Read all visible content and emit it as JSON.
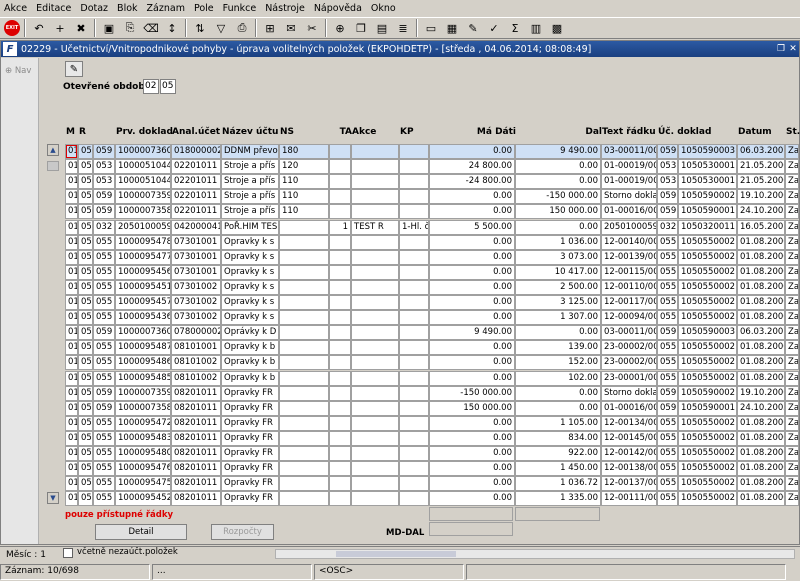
{
  "menu": [
    "Akce",
    "Editace",
    "Dotaz",
    "Blok",
    "Záznam",
    "Pole",
    "Funkce",
    "Nástroje",
    "Nápověda",
    "Okno"
  ],
  "toolbar_icons": [
    "exit-icon",
    "back-icon",
    "add-icon",
    "delete-icon",
    "save-icon",
    "copy-icon",
    "clear-icon",
    "sort-icon",
    "sort-desc-icon",
    "filter-icon",
    "print-icon",
    "attach-icon",
    "mail-icon",
    "cut-icon",
    "zoom-icon",
    "copy-doc-icon",
    "paste-icon",
    "list-icon",
    "doc-icon",
    "calc-icon",
    "edit-icon",
    "check-icon",
    "sum-icon",
    "chart-icon",
    "table-icon"
  ],
  "window": {
    "title": "02229 - Účetnictví/Vnitropodnikové pohyby - úprava volitelných položek (EKPOHDETP) - [středa , 04.06.2014; 08:08:49]",
    "nav_label": "Nav"
  },
  "period": {
    "label": "Otevřené období",
    "month": "02",
    "year": "05"
  },
  "columns": [
    {
      "key": "m",
      "label": "M",
      "align": "l"
    },
    {
      "key": "r",
      "label": "R",
      "align": "l"
    },
    {
      "key": "c",
      "label": "",
      "align": "l"
    },
    {
      "key": "doklad",
      "label": "Prv. doklad",
      "align": "l"
    },
    {
      "key": "anal",
      "label": "Anal.účet",
      "align": "l"
    },
    {
      "key": "nazev",
      "label": "Název účtu",
      "align": "l"
    },
    {
      "key": "ns",
      "label": "NS",
      "align": "l"
    },
    {
      "key": "ta",
      "label": "TA",
      "align": "r"
    },
    {
      "key": "akce",
      "label": "Akce",
      "align": "l"
    },
    {
      "key": "kp",
      "label": "KP",
      "align": "l"
    },
    {
      "key": "madati",
      "label": "Má Dáti",
      "align": "r"
    },
    {
      "key": "dal",
      "label": "Dal",
      "align": "r"
    },
    {
      "key": "text",
      "label": "Text řádku",
      "align": "l"
    },
    {
      "key": "uc",
      "label": "Úč. doklad",
      "align": "l"
    },
    {
      "key": "x",
      "label": "",
      "align": "l"
    },
    {
      "key": "datum",
      "label": "Datum",
      "align": "l"
    },
    {
      "key": "st",
      "label": "St.",
      "align": "l"
    }
  ],
  "rows": [
    [
      "01",
      "05",
      "059",
      "1000007360",
      "018000002",
      "DDNM převo",
      "180",
      "",
      "",
      "",
      "0.00",
      "9 490.00",
      "03-00011/000",
      "059",
      "1050590003",
      "06.03.2007",
      "Za"
    ],
    [
      "01",
      "05",
      "053",
      "1000051044",
      "02201011",
      "Stroje a přís",
      "120",
      "",
      "",
      "",
      "24 800.00",
      "0.00",
      "01-00019/000",
      "053",
      "1050530001",
      "21.05.2006",
      "Za"
    ],
    [
      "01",
      "05",
      "053",
      "1000051044",
      "02201011",
      "Stroje a přís",
      "110",
      "",
      "",
      "",
      "-24 800.00",
      "0.00",
      "01-00019/000",
      "053",
      "1050530001",
      "21.05.2006",
      "Za"
    ],
    [
      "01",
      "05",
      "059",
      "1000007359",
      "02201011",
      "Stroje a přís",
      "110",
      "",
      "",
      "",
      "0.00",
      "-150 000.00",
      "Storno doklad",
      "059",
      "1050590002",
      "19.10.2006",
      "Za"
    ],
    [
      "01",
      "05",
      "059",
      "1000007358",
      "02201011",
      "Stroje a přís",
      "110",
      "",
      "",
      "",
      "0.00",
      "150 000.00",
      "01-00016/000",
      "059",
      "1050590001",
      "24.10.2005",
      "Za"
    ],
    [
      "01",
      "05",
      "032",
      "2050100059",
      "042000041",
      "PoŘ.HIM TES",
      "",
      "1",
      "TEST R",
      "1-Hl. č",
      "5 500.00",
      "0.00",
      "2050100059 (",
      "032",
      "1050320011",
      "16.05.2007",
      "Za"
    ],
    [
      "01",
      "05",
      "055",
      "1000095478",
      "07301001",
      "Opravky k s",
      "",
      "",
      "",
      "",
      "0.00",
      "1 036.00",
      "12-00140/000",
      "055",
      "1050550002",
      "01.08.2006",
      "Za"
    ],
    [
      "01",
      "05",
      "055",
      "1000095477",
      "07301001",
      "Opravky k s",
      "",
      "",
      "",
      "",
      "0.00",
      "3 073.00",
      "12-00139/000",
      "055",
      "1050550002",
      "01.08.2006",
      "Za"
    ],
    [
      "01",
      "05",
      "055",
      "1000095456",
      "07301001",
      "Opravky k s",
      "",
      "",
      "",
      "",
      "0.00",
      "10 417.00",
      "12-00115/000",
      "055",
      "1050550002",
      "01.08.2006",
      "Za"
    ],
    [
      "01",
      "05",
      "055",
      "1000095451",
      "07301002",
      "Opravky k s",
      "",
      "",
      "",
      "",
      "0.00",
      "2 500.00",
      "12-00110/000",
      "055",
      "1050550002",
      "01.08.2006",
      "Za"
    ],
    [
      "01",
      "05",
      "055",
      "1000095457",
      "07301002",
      "Opravky k s",
      "",
      "",
      "",
      "",
      "0.00",
      "3 125.00",
      "12-00117/000",
      "055",
      "1050550002",
      "01.08.2006",
      "Za"
    ],
    [
      "01",
      "05",
      "055",
      "1000095436",
      "07301002",
      "Opravky k s",
      "",
      "",
      "",
      "",
      "0.00",
      "1 307.00",
      "12-00094/000",
      "055",
      "1050550002",
      "01.08.2006",
      "Za"
    ],
    [
      "01",
      "05",
      "059",
      "1000007360",
      "078000002",
      "Oprávky k D",
      "",
      "",
      "",
      "",
      "9 490.00",
      "0.00",
      "03-00011/000",
      "059",
      "1050590003",
      "06.03.2007",
      "Za"
    ],
    [
      "01",
      "05",
      "055",
      "1000095487",
      "08101001",
      "Opravky k b",
      "",
      "",
      "",
      "",
      "0.00",
      "139.00",
      "23-00002/000",
      "055",
      "1050550002",
      "01.08.2006",
      "Za"
    ],
    [
      "01",
      "05",
      "055",
      "1000095486",
      "08101002",
      "Opravky k b",
      "",
      "",
      "",
      "",
      "0.00",
      "152.00",
      "23-00002/000",
      "055",
      "1050550002",
      "01.08.2006",
      "Za"
    ],
    [
      "01",
      "05",
      "055",
      "1000095485",
      "08101002",
      "Opravky k b",
      "",
      "",
      "",
      "",
      "0.00",
      "102.00",
      "23-00001/000",
      "055",
      "1050550002",
      "01.08.2006",
      "Za"
    ],
    [
      "01",
      "05",
      "059",
      "1000007359",
      "08201011",
      "Opravky FR",
      "",
      "",
      "",
      "",
      "-150 000.00",
      "0.00",
      "Storno doklad",
      "059",
      "1050590002",
      "19.10.2006",
      "Za"
    ],
    [
      "01",
      "05",
      "059",
      "1000007358",
      "08201011",
      "Opravky FR",
      "",
      "",
      "",
      "",
      "150 000.00",
      "0.00",
      "01-00016/000",
      "059",
      "1050590001",
      "24.10.2005",
      "Za"
    ],
    [
      "01",
      "05",
      "055",
      "1000095472",
      "08201011",
      "Opravky FR",
      "",
      "",
      "",
      "",
      "0.00",
      "1 105.00",
      "12-00134/000",
      "055",
      "1050550002",
      "01.08.2006",
      "Za"
    ],
    [
      "01",
      "05",
      "055",
      "1000095483",
      "08201011",
      "Opravky FR",
      "",
      "",
      "",
      "",
      "0.00",
      "834.00",
      "12-00145/000",
      "055",
      "1050550002",
      "01.08.2006",
      "Za"
    ],
    [
      "01",
      "05",
      "055",
      "1000095480",
      "08201011",
      "Opravky FR",
      "",
      "",
      "",
      "",
      "0.00",
      "922.00",
      "12-00142/000",
      "055",
      "1050550002",
      "01.08.2006",
      "Za"
    ],
    [
      "01",
      "05",
      "055",
      "1000095476",
      "08201011",
      "Opravky FR",
      "",
      "",
      "",
      "",
      "0.00",
      "1 450.00",
      "12-00138/000",
      "055",
      "1050550002",
      "01.08.2006",
      "Za"
    ],
    [
      "01",
      "05",
      "055",
      "1000095475",
      "08201011",
      "Opravky FR",
      "",
      "",
      "",
      "",
      "0.00",
      "1 036.72",
      "12-00137/000",
      "055",
      "1050550002",
      "01.08.2006",
      "Za"
    ],
    [
      "01",
      "05",
      "055",
      "1000095452",
      "08201011",
      "Opravky FR",
      "",
      "",
      "",
      "",
      "0.00",
      "1 335.00",
      "12-00111/000",
      "055",
      "1050550002",
      "01.08.2006",
      "Za"
    ]
  ],
  "hint": "pouze přístupné řádky",
  "buttons": {
    "detail": "Detail",
    "rozpocty": "Rozpočty"
  },
  "md_dal_label": "MD-DAL",
  "checkbox_label": "včetně nezaúčt.položek",
  "status": {
    "mesic": "Měsíc : 1",
    "zaznam": "Záznam: 10/698",
    "dots": "...",
    "osc": "<OSC>"
  }
}
